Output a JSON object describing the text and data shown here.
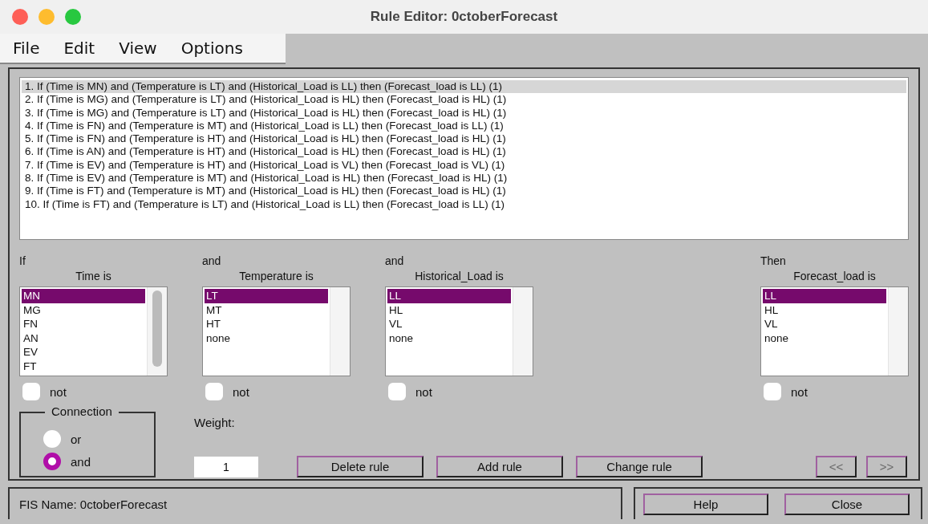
{
  "window": {
    "title": "Rule Editor: 0ctoberForecast"
  },
  "menu": [
    "File",
    "Edit",
    "View",
    "Options"
  ],
  "rules": [
    {
      "text": "1. If (Time is MN) and (Temperature is LT) and (Historical_Load is LL) then (Forecast_load is LL) (1)",
      "selected": true
    },
    {
      "text": "2. If (Time is MG) and (Temperature is LT) and (Historical_Load is HL) then (Forecast_load is HL) (1)",
      "selected": false
    },
    {
      "text": "3. If (Time is MG) and (Temperature is LT) and (Historical_Load is HL) then (Forecast_load is HL) (1)",
      "selected": false
    },
    {
      "text": "4. If (Time is FN) and (Temperature is MT) and (Historical_Load is LL) then (Forecast_load is LL) (1)",
      "selected": false
    },
    {
      "text": "5. If (Time is FN) and (Temperature is HT) and (Historical_Load is HL) then (Forecast_load is HL) (1)",
      "selected": false
    },
    {
      "text": "6. If (Time is AN) and (Temperature is HT) and (Historical_Load is HL) then (Forecast_load is HL) (1)",
      "selected": false
    },
    {
      "text": "7. If (Time is EV) and (Temperature is HT) and (Historical_Load is VL) then (Forecast_load is VL) (1)",
      "selected": false
    },
    {
      "text": "8. If (Time is EV) and (Temperature is MT) and (Historical_Load is HL) then (Forecast_load is HL) (1)",
      "selected": false
    },
    {
      "text": "9. If (Time is FT) and (Temperature is MT) and (Historical_Load is HL) then (Forecast_load is HL) (1)",
      "selected": false
    },
    {
      "text": "10. If (Time is FT) and (Temperature is LT) and (Historical_Load is LL) then (Forecast_load is LL) (1)",
      "selected": false
    }
  ],
  "selectors": [
    {
      "connector": "If",
      "heading": "Time is",
      "scrollbar": true,
      "not_label": "not",
      "not_checked": false,
      "options": [
        {
          "label": "MN",
          "selected": true
        },
        {
          "label": "MG",
          "selected": false
        },
        {
          "label": "FN",
          "selected": false
        },
        {
          "label": "AN",
          "selected": false
        },
        {
          "label": "EV",
          "selected": false
        },
        {
          "label": "FT",
          "selected": false
        }
      ]
    },
    {
      "connector": "and",
      "heading": "Temperature is",
      "scrollbar": false,
      "not_label": "not",
      "not_checked": false,
      "options": [
        {
          "label": "LT",
          "selected": true
        },
        {
          "label": "MT",
          "selected": false
        },
        {
          "label": "HT",
          "selected": false
        },
        {
          "label": "none",
          "selected": false
        }
      ]
    },
    {
      "connector": "and",
      "heading": "Historical_Load is",
      "scrollbar": false,
      "not_label": "not",
      "not_checked": false,
      "options": [
        {
          "label": "LL",
          "selected": true
        },
        {
          "label": "HL",
          "selected": false
        },
        {
          "label": "VL",
          "selected": false
        },
        {
          "label": "none",
          "selected": false
        }
      ]
    },
    {
      "connector": "Then",
      "heading": "Forecast_load is",
      "scrollbar": false,
      "not_label": "not",
      "not_checked": false,
      "options": [
        {
          "label": "LL",
          "selected": true
        },
        {
          "label": "HL",
          "selected": false
        },
        {
          "label": "VL",
          "selected": false
        },
        {
          "label": "none",
          "selected": false
        }
      ]
    }
  ],
  "connection": {
    "title": "Connection",
    "options": [
      {
        "label": "or",
        "selected": false
      },
      {
        "label": "and",
        "selected": true
      }
    ]
  },
  "weight": {
    "label": "Weight:",
    "value": "1"
  },
  "rule_buttons": [
    "Delete rule",
    "Add rule",
    "Change rule"
  ],
  "nav_buttons": [
    {
      "label": "<<",
      "disabled": true
    },
    {
      "label": ">>",
      "disabled": true
    }
  ],
  "status": "FIS Name: 0ctoberForecast",
  "footer_buttons": [
    "Help",
    "Close"
  ]
}
